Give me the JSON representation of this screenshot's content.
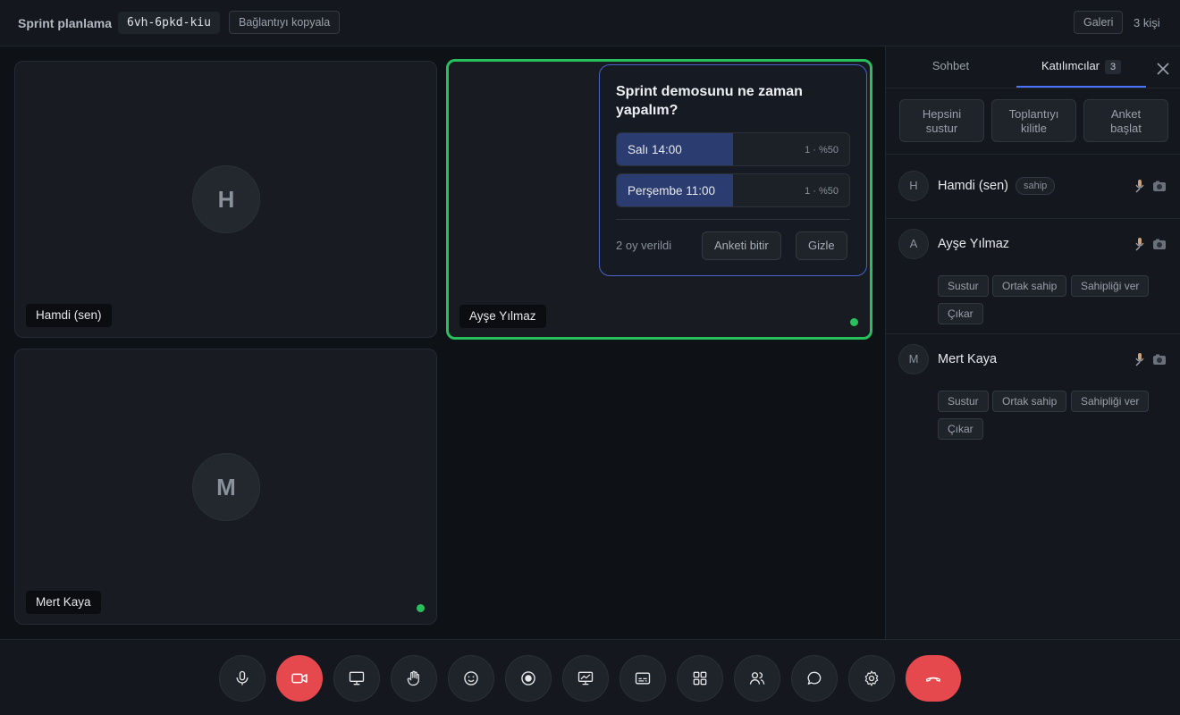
{
  "header": {
    "title": "Sprint planlama",
    "meeting_code": "6vh-6pkd-kiu",
    "copy_link_label": "Bağlantıyı kopyala",
    "layout_label": "Galeri",
    "participant_count": "3 kişi"
  },
  "tiles": [
    {
      "name": "Hamdi (sen)",
      "initial": "H",
      "speaking": false,
      "audio_active": false
    },
    {
      "name": "Ayşe Yılmaz",
      "initial": "A",
      "speaking": true,
      "audio_active": true
    },
    {
      "name": "Mert Kaya",
      "initial": "M",
      "speaking": false,
      "audio_active": true
    }
  ],
  "poll": {
    "question": "Sprint demosunu ne zaman yapalım?",
    "options": [
      {
        "label": "Salı 14:00",
        "stat": "1 · %50",
        "percent": 50
      },
      {
        "label": "Perşembe 11:00",
        "stat": "1 · %50",
        "percent": 50
      }
    ],
    "votes_text": "2 oy verildi",
    "end_label": "Anketi bitir",
    "hide_label": "Gizle"
  },
  "sidebar": {
    "tabs": [
      {
        "label": "Sohbet",
        "active": false
      },
      {
        "label": "Katılımcılar",
        "badge": "3",
        "active": true
      }
    ],
    "actions": {
      "mute_all_line1": "Hepsini",
      "mute_all_line2": "sustur",
      "lock_line1": "Toplantıyı",
      "lock_line2": "kilitle",
      "poll_line1": "Anket",
      "poll_line2": "başlat"
    },
    "participants": [
      {
        "initial": "H",
        "name": "Hamdi (sen)",
        "badge": "sahip"
      },
      {
        "initial": "A",
        "name": "Ayşe Yılmaz",
        "controls": {
          "mute": "Sustur",
          "cohost": "Ortak sahip",
          "transfer": "Sahipliği ver",
          "remove": "Çıkar"
        }
      },
      {
        "initial": "M",
        "name": "Mert Kaya",
        "controls": {
          "mute": "Sustur",
          "cohost": "Ortak sahip",
          "transfer": "Sahipliği ver",
          "remove": "Çıkar"
        }
      }
    ]
  },
  "colors": {
    "accent": "#4a72ff",
    "speaking": "#27c05d",
    "danger": "#e5484d",
    "poll_fill": "#2a3c70"
  },
  "icons": {
    "controls": [
      "microphone-icon",
      "camera-off-icon",
      "screen-share-icon",
      "raise-hand-icon",
      "emoji-icon",
      "record-icon",
      "whiteboard-icon",
      "captions-icon",
      "layout-grid-icon",
      "participants-icon",
      "chat-icon",
      "settings-icon",
      "hang-up-icon"
    ]
  }
}
